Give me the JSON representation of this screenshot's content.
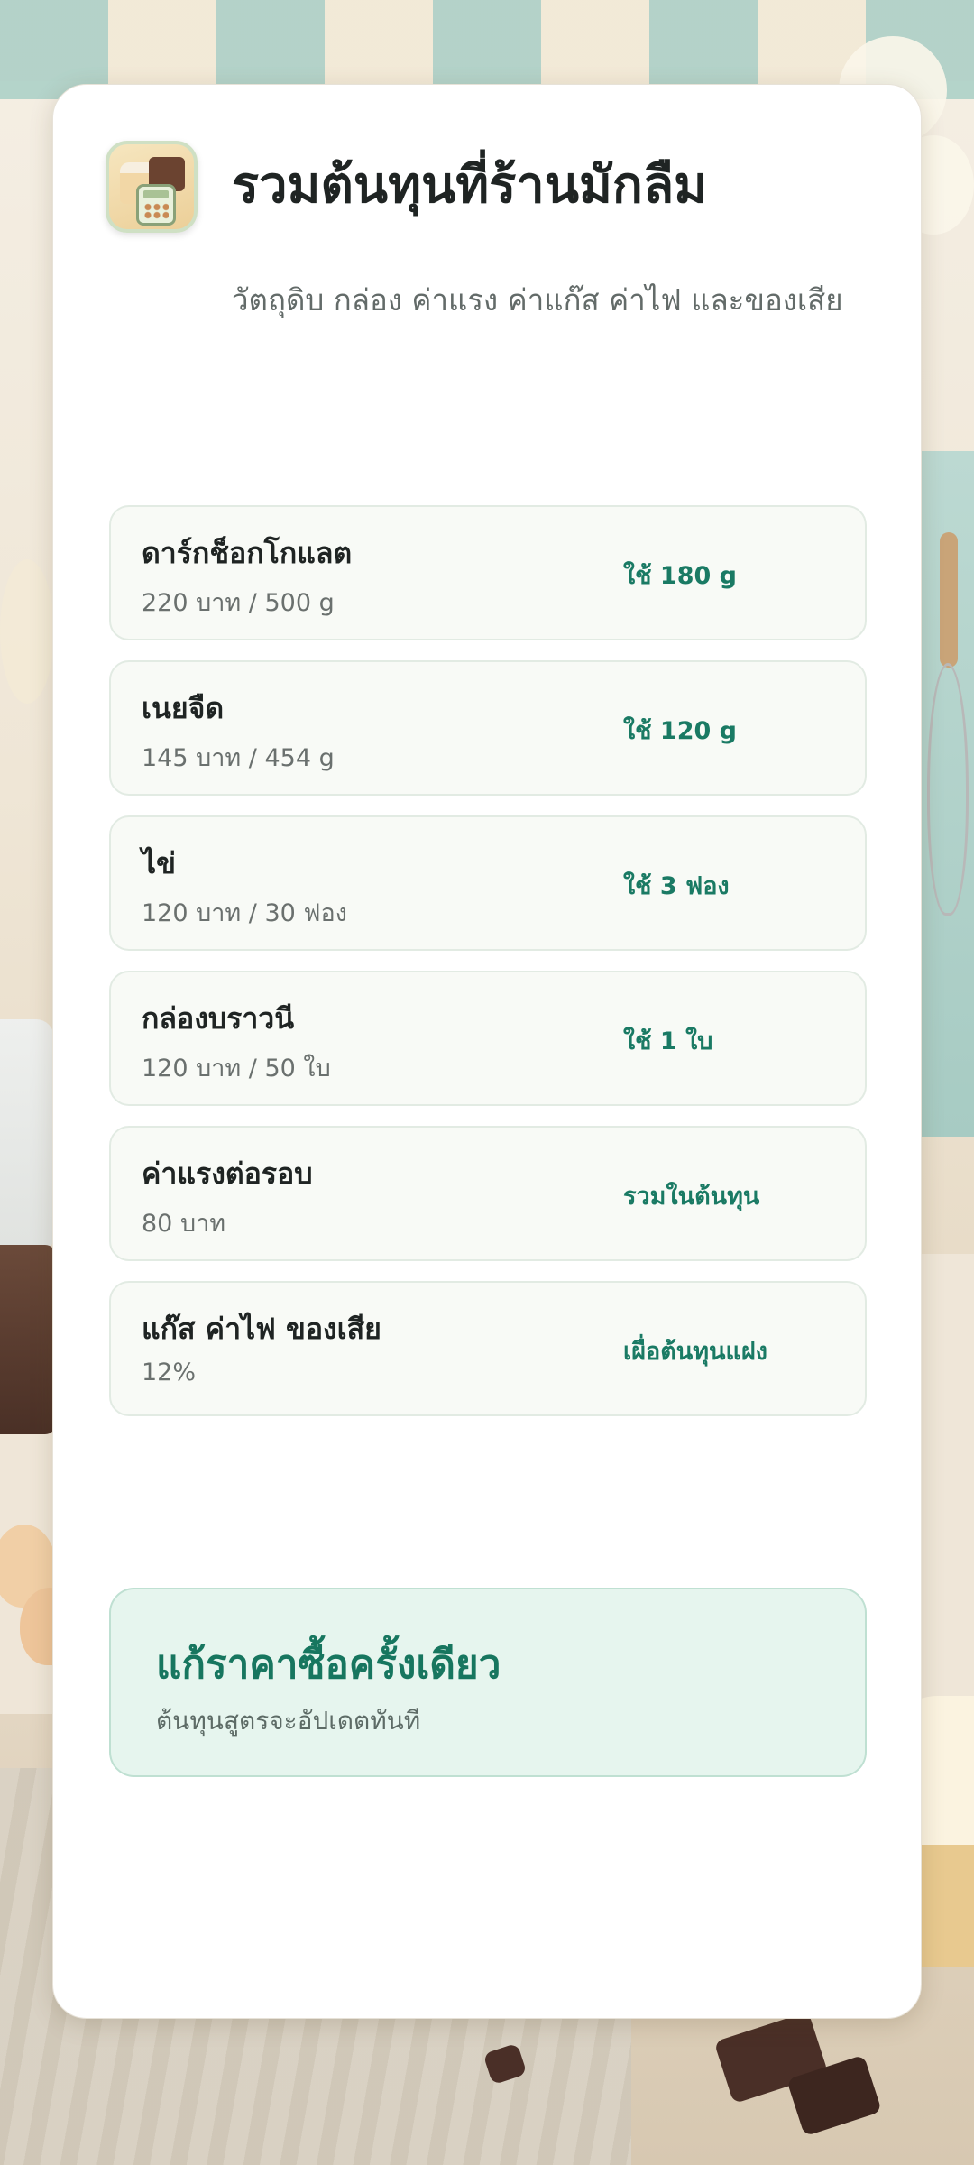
{
  "header": {
    "title": "รวมต้นทุนที่ร้านมักลืม",
    "subtitle": "วัตถุดิบ กล่อง ค่าแรง ค่าแก๊ส ค่าไฟ และของเสีย",
    "app_icon": "bakery-calculator-icon"
  },
  "items": [
    {
      "name": "ดาร์กช็อกโกแลต",
      "price": "220 บาท / 500 g",
      "usage": "ใช้ 180 g"
    },
    {
      "name": "เนยจืด",
      "price": "145 บาท / 454 g",
      "usage": "ใช้ 120 g"
    },
    {
      "name": "ไข่",
      "price": "120 บาท / 30 ฟอง",
      "usage": "ใช้ 3 ฟอง"
    },
    {
      "name": "กล่องบราวนี",
      "price": "120 บาท / 50 ใบ",
      "usage": "ใช้ 1 ใบ"
    },
    {
      "name": "ค่าแรงต่อรอบ",
      "price": "80 บาท",
      "usage": "รวมในต้นทุน"
    },
    {
      "name": "แก๊ส ค่าไฟ ของเสีย",
      "price": "12%",
      "usage": "เผื่อต้นทุนแฝง"
    }
  ],
  "promo": {
    "title": "แก้ราคาซื้อครั้งเดียว",
    "subtitle": "ต้นทุนสูตรจะอัปเดตทันที"
  },
  "colors": {
    "accent": "#1a7a64",
    "row_bg": "#f8faf6",
    "promo_bg": "#e6f5ee"
  }
}
